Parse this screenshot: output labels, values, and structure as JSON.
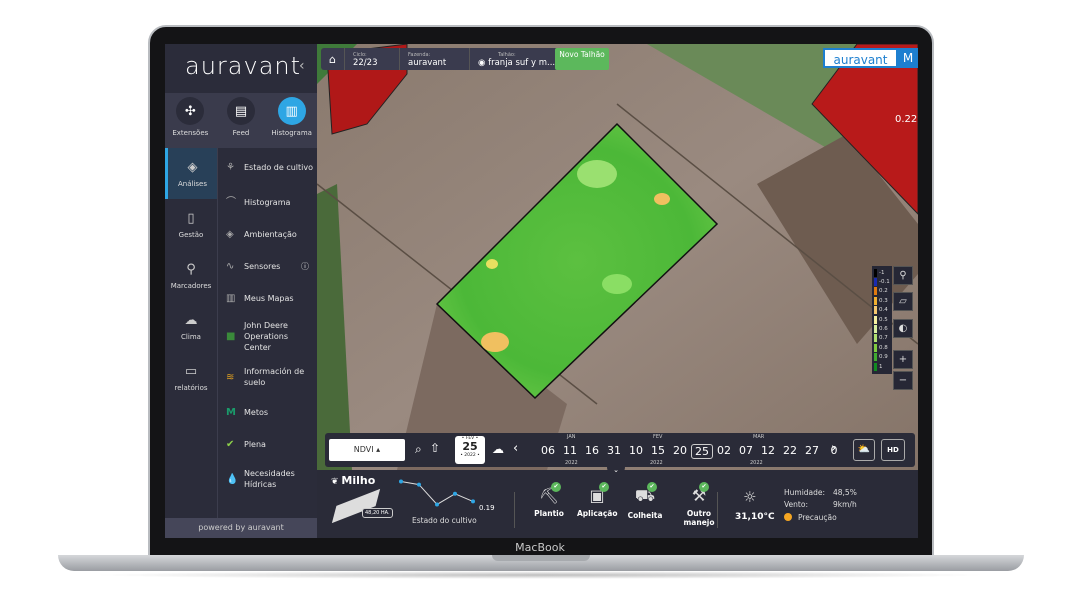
{
  "device_label": "MacBook",
  "sidebar": {
    "logo": "auravant",
    "top_items": [
      {
        "label": "Extensões",
        "icon": "puzzle-icon"
      },
      {
        "label": "Feed",
        "icon": "chat-icon"
      },
      {
        "label": "Histograma",
        "icon": "histogram-icon",
        "active": true
      }
    ],
    "left_items": [
      {
        "label": "Análises",
        "icon": "layers-icon",
        "active": true
      },
      {
        "label": "Gestão",
        "icon": "book-icon"
      },
      {
        "label": "Marcadores",
        "icon": "pin-icon"
      },
      {
        "label": "Clima",
        "icon": "cloud-icon"
      },
      {
        "label": "relatórios",
        "icon": "clipboard-icon"
      }
    ],
    "sub_items": [
      {
        "label": "Estado de cultivo"
      },
      {
        "label": "Histograma"
      },
      {
        "label": "Ambientação"
      },
      {
        "label": "Sensores"
      },
      {
        "label": "Meus Mapas"
      },
      {
        "label": "John Deere Operations Center"
      },
      {
        "label": "Información de suelo"
      },
      {
        "label": "Metos"
      },
      {
        "label": "Plena"
      },
      {
        "label": "Necesidades Hídricas"
      }
    ],
    "powered": "powered by auravant"
  },
  "header": {
    "ciclo_label": "Ciclo:",
    "ciclo": "22/23",
    "fazenda_label": "Fazenda:",
    "fazenda": "auravant",
    "talhao_label": "Talhão:",
    "talhao": "franja suf y m...",
    "novo": "Novo Talhão",
    "brand": "auravant",
    "brand_m": "M"
  },
  "map": {
    "value_label": "0.22",
    "legend": [
      "-1",
      "-0.1",
      "0.2",
      "0.3",
      "0.4",
      "0.5",
      "0.6",
      "0.7",
      "0.8",
      "0.9",
      "1"
    ],
    "legend_colors": [
      "#000000",
      "#1a2bb0",
      "#e07a10",
      "#f2b030",
      "#f5c870",
      "#f5f0a0",
      "#d8eea0",
      "#b0e070",
      "#80cc40",
      "#40aa30",
      "#108a20"
    ],
    "zoom_in": "+",
    "zoom_out": "−"
  },
  "timeline": {
    "layer": "NDVI ▴",
    "date_month": "• FEV •",
    "date_day": "25",
    "date_year": "• 2022 •",
    "months": [
      "JAN",
      "FEV",
      "MAR"
    ],
    "years": [
      "2022",
      "2022",
      "2022"
    ],
    "dates": [
      "06",
      "11",
      "16",
      "31",
      "10",
      "15",
      "20",
      "25",
      "02",
      "07",
      "12",
      "22",
      "27",
      "0"
    ],
    "selected": "25",
    "hd": "HD"
  },
  "bottom": {
    "crop": "Milho",
    "area": "48,20 HA.",
    "ndvi_value": "0.19",
    "ndvi_series": [
      0.32,
      0.3,
      0.17,
      0.24,
      0.19
    ],
    "status_label": "Estado do cultivo",
    "actions": [
      "Plantio",
      "Aplicação",
      "Colheita",
      "Outro manejo"
    ],
    "temp": "31,10°C",
    "humidity_label": "Humidade:",
    "humidity": "48,5%",
    "wind_label": "Vento:",
    "wind": "9km/h",
    "alert": "Precaução",
    "alert_color": "#f5a623"
  }
}
